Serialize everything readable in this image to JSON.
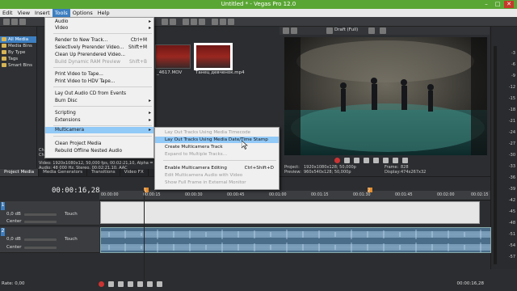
{
  "window": {
    "title": "Untitled * - Vegas Pro 12.0"
  },
  "menubar": {
    "items": [
      "Edit",
      "View",
      "Insert",
      "Tools",
      "Options",
      "Help"
    ],
    "active": "Tools"
  },
  "explorer": {
    "items": [
      "All Media",
      "Media Bins",
      "By Type",
      "Tags",
      "Smart Bins"
    ]
  },
  "media": {
    "thumb1_label": "_4617.MOV",
    "thumb2_label": "Танец девченок.mp4",
    "info_lines": [
      "Ch",
      "Ch",
      "Video: 1920x1080x12, 50,000 fps, 00:02:21,10, Alpha = No",
      "Audio: 48 000 Hz, Stereo, 00:02:21,10, AAC"
    ],
    "tabs": [
      "Project Media",
      "Media Generators",
      "Transitions",
      "Video FX"
    ]
  },
  "tools_menu": {
    "items": [
      {
        "label": "Audio",
        "shortcut": "",
        "arrow": true,
        "disabled": false
      },
      {
        "label": "Video",
        "shortcut": "",
        "arrow": true,
        "disabled": false
      },
      {
        "label": "Render to New Track...",
        "shortcut": "Ctrl+M",
        "arrow": false,
        "disabled": false
      },
      {
        "label": "Selectively Prerender Video...",
        "shortcut": "Shift+M",
        "arrow": false,
        "disabled": false
      },
      {
        "label": "Clean Up Prerendered Video...",
        "shortcut": "",
        "arrow": false,
        "disabled": false
      },
      {
        "label": "Build Dynamic RAM Preview",
        "shortcut": "Shift+B",
        "arrow": false,
        "disabled": true
      },
      {
        "label": "Print Video to Tape...",
        "shortcut": "",
        "arrow": false,
        "disabled": false
      },
      {
        "label": "Print Video to HDV Tape...",
        "shortcut": "",
        "arrow": false,
        "disabled": false
      },
      {
        "label": "Lay Out Audio CD from Events",
        "shortcut": "",
        "arrow": false,
        "disabled": false
      },
      {
        "label": "Burn Disc",
        "shortcut": "",
        "arrow": true,
        "disabled": false
      },
      {
        "label": "Scripting",
        "shortcut": "",
        "arrow": true,
        "disabled": false
      },
      {
        "label": "Extensions",
        "shortcut": "",
        "arrow": true,
        "disabled": false
      },
      {
        "label": "Multicamera",
        "shortcut": "",
        "arrow": true,
        "disabled": false
      },
      {
        "label": "Clean Project Media",
        "shortcut": "",
        "arrow": false,
        "disabled": false
      },
      {
        "label": "Rebuild Offline Nested Audio",
        "shortcut": "",
        "arrow": false,
        "disabled": false
      }
    ]
  },
  "multicamera_menu": {
    "items": [
      {
        "label": "Lay Out Tracks Using Media Timecode",
        "shortcut": "",
        "disabled": true
      },
      {
        "label": "Lay Out Tracks Using Media Date/Time Stamp",
        "shortcut": "",
        "disabled": false
      },
      {
        "label": "Create Multicamera Track",
        "shortcut": "",
        "disabled": false
      },
      {
        "label": "Expand to Multiple Tracks...",
        "shortcut": "",
        "disabled": true
      },
      {
        "label": "Enable Multicamera Editing",
        "shortcut": "Ctrl+Shift+D",
        "disabled": false
      },
      {
        "label": "Edit Multicamera Audio with Video",
        "shortcut": "",
        "disabled": true
      },
      {
        "label": "Show Full Frame in External Monitor",
        "shortcut": "",
        "disabled": true
      }
    ]
  },
  "preview": {
    "quality": "Draft (Full)",
    "project_label": "Project:",
    "project_value": "1920x1080x128; 50,000p",
    "preview_label": "Preview:",
    "preview_value": "960x540x128; 50,000p",
    "frame_label": "Frame:",
    "frame_value": "828",
    "display_label": "Display:",
    "display_value": "474x267x32"
  },
  "meters": {
    "labels": [
      "-3",
      "-6",
      "-9",
      "-12",
      "-15",
      "-18",
      "-21",
      "-24",
      "-27",
      "-30",
      "-33",
      "-36",
      "-39",
      "-42",
      "-45",
      "-48",
      "-51",
      "-54",
      "-57"
    ]
  },
  "timeline": {
    "time": "00:00:16,28",
    "ruler": [
      "00:00:00",
      "00:00:15",
      "00:00:30",
      "00:00:45",
      "00:01:00",
      "00:01:15",
      "00:01:30",
      "00:01:45",
      "00:02:00",
      "00:02:15"
    ],
    "marker1": "1",
    "marker2": "2",
    "track1": {
      "num": "1",
      "level_label": "0,0 dB",
      "level_label2": "Center",
      "touch": "Touch"
    },
    "track2": {
      "num": "2",
      "level_label": "0,0 dB",
      "level_label2": "Center",
      "touch": "Touch"
    },
    "rate": "Rate: 0,00",
    "end_time": "00:00:16,28"
  }
}
